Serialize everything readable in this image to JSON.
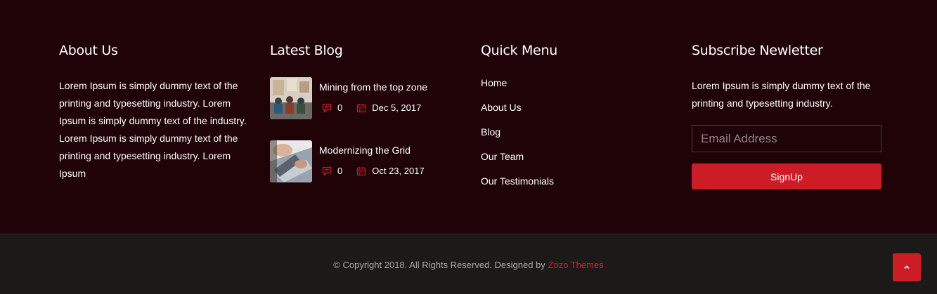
{
  "about": {
    "title": "About Us",
    "text": "Lorem Ipsum is simply dummy text of the printing and typesetting industry. Lorem Ipsum is simply dummy text of the industry. Lorem Ipsum is simply dummy text of the printing and typesetting industry. Lorem Ipsum"
  },
  "blog": {
    "title": "Latest Blog",
    "posts": [
      {
        "title": "Mining from the top zone",
        "comments": "0",
        "date": "Dec 5, 2017",
        "thumb_icon": "team-meeting-photo"
      },
      {
        "title": "Modernizing the Grid",
        "comments": "0",
        "date": "Oct 23, 2017",
        "thumb_icon": "laptop-typing-photo"
      }
    ]
  },
  "menu": {
    "title": "Quick Menu",
    "items": [
      "Home",
      "About Us",
      "Blog",
      "Our Team",
      "Our Testimonials"
    ]
  },
  "subscribe": {
    "title": "Subscribe Newletter",
    "text": "Lorem Ipsum is simply dummy text of the printing and typesetting industry.",
    "email_placeholder": "Email Address",
    "email_value": "",
    "button_label": "SignUp"
  },
  "bottom": {
    "copyright_text": "© Copyright 2018. All Rights Reserved. Designed by ",
    "designer_link": "Zozo Themes",
    "scroll_top_icon": "chevron-up-icon"
  },
  "colors": {
    "footer_bg": "#1f0307",
    "bottom_bg": "#1b1a18",
    "accent": "#cc1d27"
  }
}
